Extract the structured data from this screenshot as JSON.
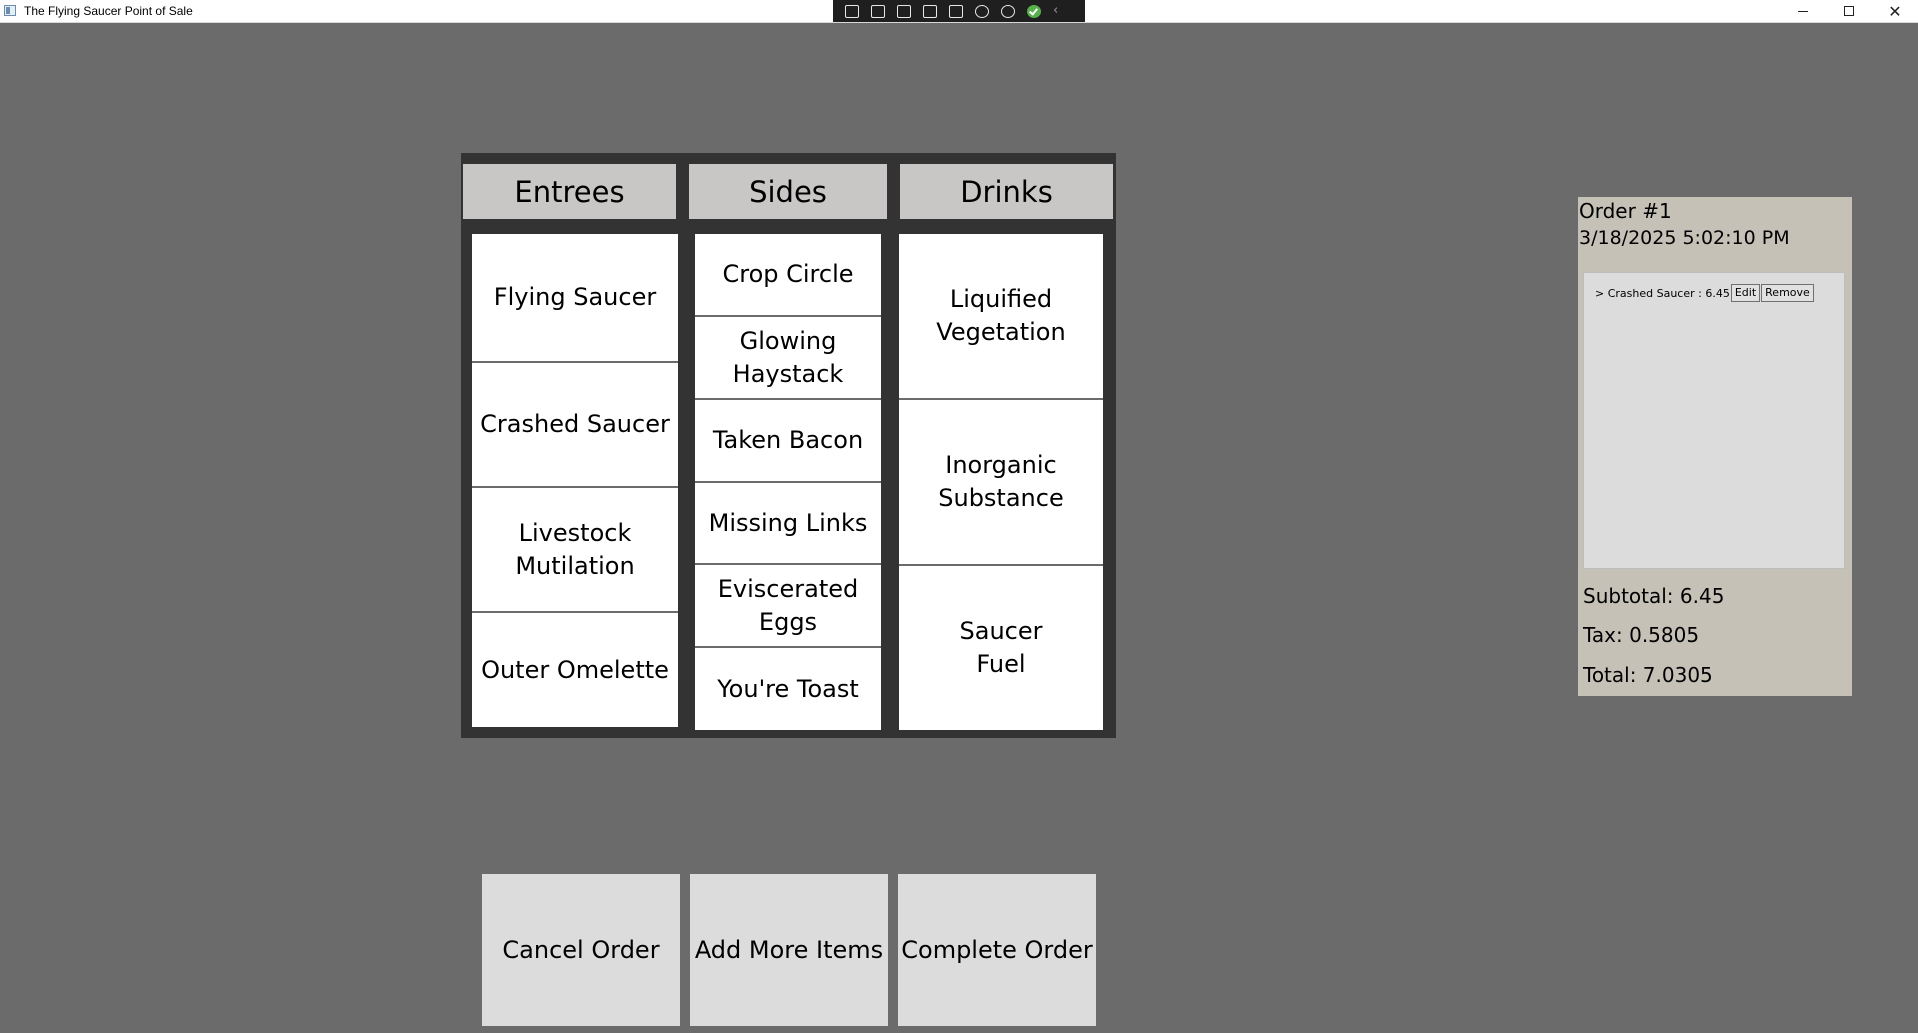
{
  "window": {
    "title": "The Flying Saucer Point of Sale",
    "minimize_icon": "minimize-icon",
    "maximize_icon": "restore-icon",
    "close_glyph": "✕"
  },
  "menu": {
    "entrees": {
      "header": "Entrees",
      "items": [
        "Flying Saucer",
        "Crashed Saucer",
        "Livestock\nMutilation",
        "Outer Omelette"
      ]
    },
    "sides": {
      "header": "Sides",
      "items": [
        "Crop Circle",
        "Glowing Haystack",
        "Taken Bacon",
        "Missing Links",
        "Eviscerated Eggs",
        "You're Toast"
      ]
    },
    "drinks": {
      "header": "Drinks",
      "items": [
        "Liquified\nVegetation",
        "Inorganic\nSubstance",
        "Saucer\nFuel"
      ]
    }
  },
  "order": {
    "number": "Order #1",
    "datetime": "3/18/2025 5:02:10 PM",
    "lines": [
      {
        "text": "> Crashed Saucer : 6.45",
        "edit_label": "Edit",
        "remove_label": "Remove"
      }
    ],
    "subtotal": "Subtotal: 6.45",
    "tax": "Tax: 0.5805",
    "total": "Total: 7.0305"
  },
  "actions": {
    "cancel": "Cancel Order",
    "add_more": "Add More Items",
    "complete": "Complete Order"
  },
  "colors": {
    "background": "#6b6b6b",
    "panel": "#333333",
    "header": "#c9c6c6",
    "order_panel": "#c5c1b7"
  }
}
